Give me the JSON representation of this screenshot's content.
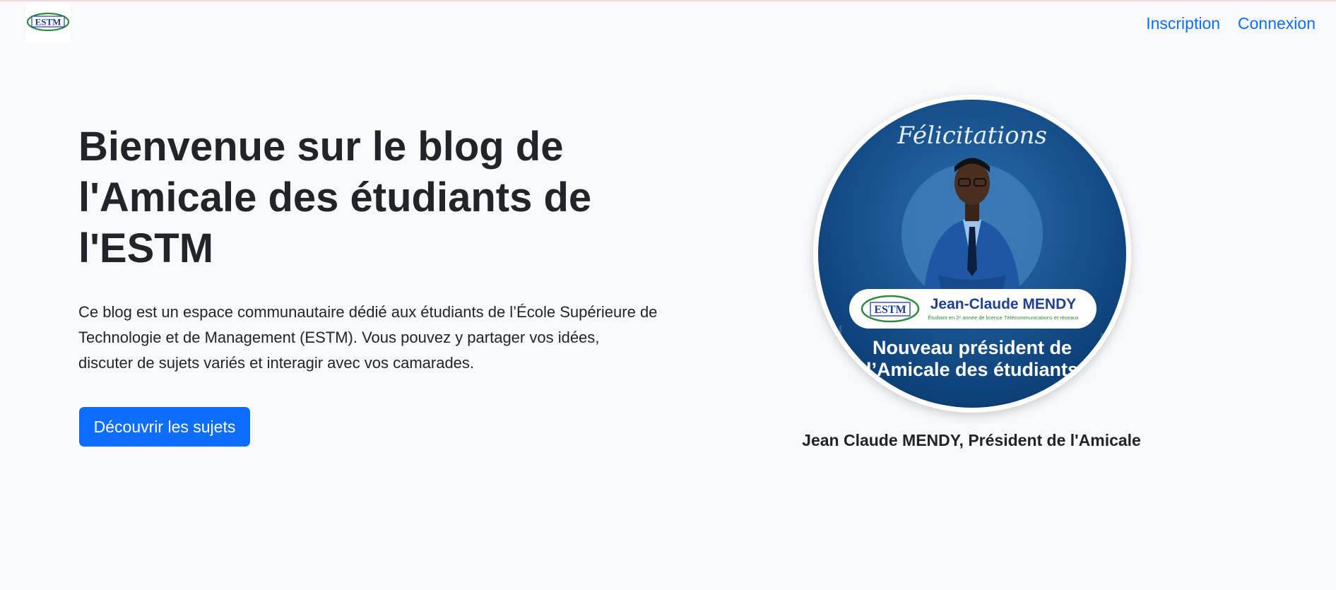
{
  "brand": {
    "logo_text": "ESTM",
    "colors": {
      "logo_blue": "#1f3f94",
      "logo_green": "#2e8b3e"
    }
  },
  "nav": {
    "links": [
      {
        "label": "Inscription"
      },
      {
        "label": "Connexion"
      }
    ],
    "link_color": "#0d6efd"
  },
  "hero": {
    "title": "Bienvenue sur le blog de l'Amicale des étudiants de l'ESTM",
    "description": "Ce blog est un espace communautaire dédié aux étudiants de l’École Supérieure de Technologie et de Management (ESTM). Vous pouvez y partager vos idées, discuter de sujets variés et interagir avec vos camarades.",
    "cta_label": "Découvrir les sujets",
    "cta_color": "#0d6efd"
  },
  "portrait": {
    "script_heading": "Félicitations",
    "badge_logo_text": "ESTM",
    "badge_name": "Jean-Claude MENDY",
    "badge_subtitle": "Étudiant en 2ᵉ année de licence Télécommunications et réseaux",
    "headline_line1": "Nouveau président de",
    "headline_line2": "l’Amicale des étudiants",
    "background_color": "#0f4c8a",
    "caption": "Jean Claude MENDY, Président de l'Amicale"
  }
}
